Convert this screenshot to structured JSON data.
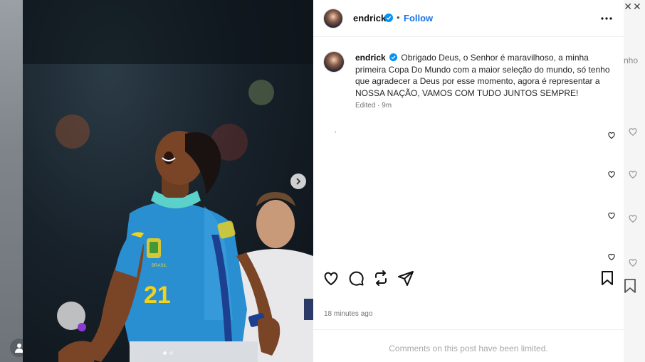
{
  "window": {
    "close_symbol": "✕✕",
    "ghost_text": "nho"
  },
  "post": {
    "username": "endrick",
    "follow_label": "Follow",
    "separator": "•",
    "caption_username": "endrick",
    "caption_text": "Obrigado Deus, o Senhor é maravilhoso, a minha primeira Copa Do Mundo com a maior seleção do mundo, só tenho que agradecer a Deus por esse momento, agora é representar a NOSSA NAÇÃO, VAMOS COM TUDO JUNTOS SEMPRE!",
    "edited_meta": "Edited · 9m",
    "tiny_mark": "ʼ",
    "posted_time": "18 minutes ago",
    "comments_limited": "Comments on this post have been limited."
  },
  "photo": {
    "jersey_number": "21",
    "jersey_badge": "BRASIL"
  },
  "icons": {
    "verified": "verified-badge-icon",
    "more": "more-options-icon",
    "like": "heart-icon",
    "comment": "comment-icon",
    "repost": "repost-icon",
    "share": "share-icon",
    "save": "bookmark-icon",
    "next": "chevron-right-icon"
  },
  "colors": {
    "accent": "#1a73e8",
    "verified": "#0095f6",
    "jersey": "#2a8fd1",
    "jersey_yellow": "#f2d21b"
  }
}
